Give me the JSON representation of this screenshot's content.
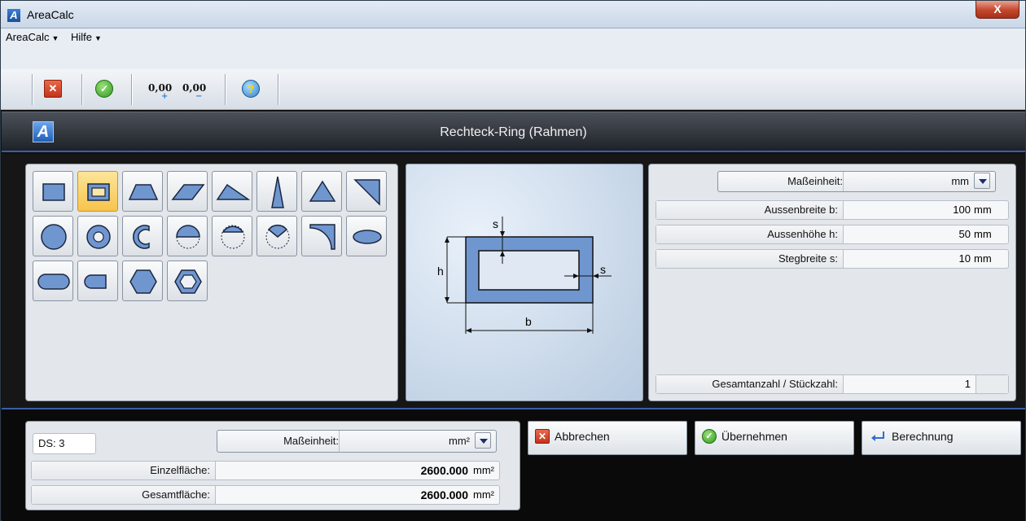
{
  "window": {
    "title": "AreaCalc",
    "close_label": "X"
  },
  "menu": {
    "items": [
      {
        "label": "AreaCalc"
      },
      {
        "label": "Hilfe"
      }
    ]
  },
  "toolbar": {
    "cancel_icon": "x-icon",
    "ok_icon": "check-icon",
    "decimals_plus_label": "0,00",
    "decimals_minus_label": "0,00",
    "help_icon": "help-icon"
  },
  "header": {
    "title": "Rechteck-Ring (Rahmen)"
  },
  "shapes": {
    "selected": "rectangle-ring",
    "items": [
      "rectangle",
      "rectangle-ring",
      "trapezoid",
      "parallelogram",
      "triangle-obtuse",
      "triangle-isoceles",
      "triangle-equilateral",
      "triangle-right",
      "circle",
      "circle-ring",
      "circle-sector",
      "half-circle",
      "circle-segment",
      "circle-sector-cut",
      "spandrel",
      "ellipse",
      "slot",
      "semi-slot",
      "hexagon",
      "hexagon-ring"
    ]
  },
  "diagram": {
    "label_s_top": "s",
    "label_h": "h",
    "label_s_right": "s",
    "label_b": "b"
  },
  "inputs": {
    "unit_label": "Maßeinheit:",
    "unit_value": "mm",
    "fields": [
      {
        "label": "Aussenbreite b:",
        "value": "100",
        "unit": "mm"
      },
      {
        "label": "Aussenhöhe h:",
        "value": "50",
        "unit": "mm"
      },
      {
        "label": "Stegbreite s:",
        "value": "10",
        "unit": "mm"
      }
    ],
    "count_label": "Gesamtanzahl / Stückzahl:",
    "count_value": "1"
  },
  "results": {
    "ds_label": "DS:  3",
    "unit_label": "Maßeinheit:",
    "unit_value": "mm²",
    "single_label": "Einzelfläche:",
    "single_value": "2600.000",
    "single_unit": "mm²",
    "total_label": "Gesamtfläche:",
    "total_value": "2600.000",
    "total_unit": "mm²"
  },
  "actions": {
    "cancel": "Abbrechen",
    "apply": "Übernehmen",
    "calculate": "Berechnung"
  },
  "colors": {
    "shape_fill": "#6f96cf",
    "accent": "#3a5fa8",
    "selected_bg": "#f7c44c"
  }
}
